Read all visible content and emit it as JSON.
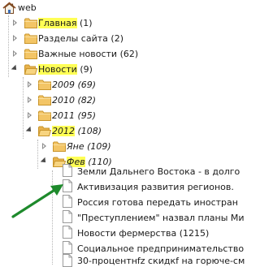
{
  "tree": {
    "root": {
      "label": "web",
      "icon": "home-icon"
    },
    "nodes": [
      {
        "id": "glavnaya",
        "name": "Главная",
        "count": "(1)",
        "highlight": true,
        "state": "collapsed"
      },
      {
        "id": "razdely",
        "name": "Разделы сайта",
        "count": "(2)",
        "highlight": false,
        "state": "collapsed"
      },
      {
        "id": "vazhnye",
        "name": "Важные новости",
        "count": "(62)",
        "highlight": false,
        "state": "collapsed"
      },
      {
        "id": "novosti",
        "name": "Новости",
        "count": "(9)",
        "highlight": true,
        "state": "expanded"
      },
      {
        "id": "y2009",
        "name": "2009",
        "count": "(69)",
        "highlight": false,
        "state": "collapsed"
      },
      {
        "id": "y2010",
        "name": "2010",
        "count": "(82)",
        "highlight": false,
        "state": "collapsed"
      },
      {
        "id": "y2011",
        "name": "2011",
        "count": "(95)",
        "highlight": false,
        "state": "collapsed"
      },
      {
        "id": "y2012",
        "name": "2012",
        "count": "(108)",
        "highlight": true,
        "state": "expanded"
      },
      {
        "id": "yanv",
        "name": "Яне",
        "count": "(109)",
        "highlight": false,
        "state": "collapsed"
      },
      {
        "id": "fev",
        "name": "Фев",
        "count": "(110)",
        "highlight": true,
        "state": "expanded"
      }
    ],
    "documents": [
      "Земли Дальнего Востока - в долго",
      "Активизация развития регионов.",
      "Россия готова передать иностран",
      "\"Преступлением\" назвал планы Ми",
      "Новости фермерства (1215)",
      "Социальное предпринимательство",
      "30-процентнfz скидкf на горюче-см"
    ]
  },
  "colors": {
    "highlight": "#ffff55",
    "folder": "#f3c566",
    "arrow": "#1e8a2c"
  }
}
